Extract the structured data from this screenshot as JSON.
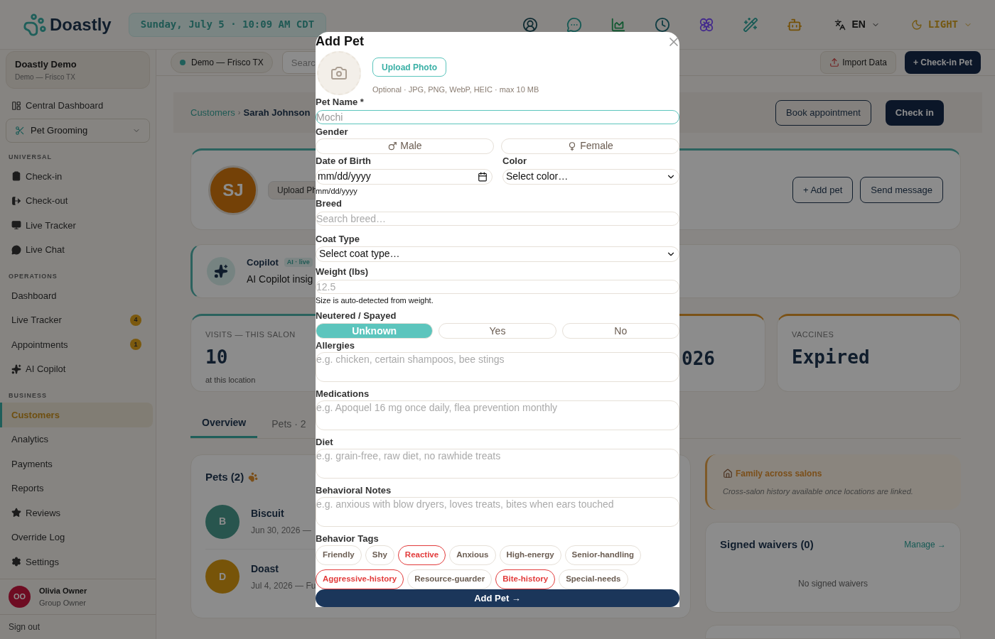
{
  "top_bar": {
    "logo": "Doastly",
    "datetime": "Sunday, July 5 · 10:09 AM CDT",
    "language": "EN",
    "theme": "LIGHT"
  },
  "sidebar": {
    "account": {
      "name": "Doastly Demo",
      "location": "Demo — Frisco TX"
    },
    "central_dashboard": "Central Dashboard",
    "business_type": "Pet Grooming",
    "sections": [
      {
        "title": "UNIVERSAL",
        "items": [
          {
            "label": "Check-in",
            "selected": false
          },
          {
            "label": "Check-out",
            "selected": false
          },
          {
            "label": "Live Tracker",
            "selected": false
          },
          {
            "label": "Live Chat",
            "selected": false
          }
        ]
      },
      {
        "title": "OPERATIONS",
        "items": [
          {
            "label": "Dashboard",
            "selected": false
          },
          {
            "label": "Live Tracker",
            "selected": false,
            "badge": "4"
          },
          {
            "label": "Appointments",
            "selected": false,
            "badge": "1"
          },
          {
            "label": "AI Copilot",
            "selected": false
          }
        ]
      },
      {
        "title": "BUSINESS",
        "items": [
          {
            "label": "Customers",
            "selected": true
          },
          {
            "label": "Analytics",
            "selected": false
          },
          {
            "label": "Payments",
            "selected": false
          },
          {
            "label": "Reports",
            "selected": false
          },
          {
            "label": "Reviews",
            "selected": false
          },
          {
            "label": "Override Log",
            "selected": false
          },
          {
            "label": "Settings",
            "selected": false
          }
        ]
      }
    ],
    "user": {
      "initials": "OO",
      "name": "Olivia Owner",
      "role": "Group Owner"
    },
    "sign_out": "Sign out"
  },
  "toolbar": {
    "location": "Demo — Frisco TX",
    "search_placeholder": "Searc",
    "import": "Import Data",
    "check_in_pet": "+ Check-in Pet"
  },
  "customer": {
    "breadcrumb": {
      "parent": "Customers",
      "separator": "›",
      "current": "Sarah Johnson"
    },
    "actions": [
      "Book appointment",
      "Check in"
    ],
    "initials": "SJ",
    "upload": "Upload Ph",
    "card_actions": [
      "+ Add pet",
      "Send message"
    ],
    "copilot": {
      "title": "Copilot",
      "badge": "AI · live",
      "text": "AI Copilot insig"
    },
    "stats": [
      {
        "label": "VISITS — THIS SALON",
        "value": "10",
        "note": "at this location"
      },
      {
        "value": "026"
      },
      {
        "label": "VACCINES",
        "value": "Expired"
      }
    ],
    "tabs": [
      {
        "label": "Overview",
        "selected": true
      },
      {
        "label": "Pets · 2",
        "selected": false
      }
    ],
    "pets_title": "Pets (2)",
    "pets": [
      {
        "initial": "B",
        "name": "Biscuit",
        "detail": "Jun 30, 2026 —"
      },
      {
        "initial": "D",
        "name": "Doast",
        "detail": "Jul 4, 2026 — Fu"
      }
    ],
    "family": {
      "title": "Family across salons",
      "text": "Cross-salon history available once locations are linked."
    },
    "waivers": {
      "title": "Signed waivers (0)",
      "link": "Manage →",
      "empty": "No signed waivers"
    }
  },
  "modal": {
    "title": "Add Pet",
    "upload_button": "Upload Photo",
    "upload_hint": "Optional · JPG, PNG, WebP, HEIC · max 10 MB",
    "pet_name": {
      "label": "Pet Name *",
      "placeholder": "Mochi"
    },
    "gender": {
      "label": "Gender",
      "options": [
        {
          "label": "Male",
          "selected": false
        },
        {
          "label": "Female",
          "selected": false
        }
      ]
    },
    "date_of_birth": {
      "label": "Date of Birth",
      "value": "mm/dd/yyyy",
      "hint": "mm/dd/yyyy"
    },
    "color": {
      "label": "Color",
      "value": "Select color…"
    },
    "breed": {
      "label": "Breed",
      "placeholder": "Search breed…"
    },
    "coat_type": {
      "label": "Coat Type",
      "value": "Select coat type…"
    },
    "weight": {
      "label": "Weight (lbs)",
      "placeholder": "12.5",
      "hint": "Size is auto-detected from weight."
    },
    "neutered": {
      "label": "Neutered / Spayed",
      "options": [
        {
          "label": "Unknown",
          "selected": true
        },
        {
          "label": "Yes",
          "selected": false
        },
        {
          "label": "No",
          "selected": false
        }
      ]
    },
    "notes": [
      {
        "label": "Allergies",
        "placeholder": "e.g. chicken, certain shampoos, bee stings"
      },
      {
        "label": "Medications",
        "placeholder": "e.g. Apoquel 16 mg once daily, flea prevention monthly"
      },
      {
        "label": "Diet",
        "placeholder": "e.g. grain-free, raw diet, no rawhide treats"
      },
      {
        "label": "Behavioral Notes",
        "placeholder": "e.g. anxious with blow dryers, loves treats, bites when ears touched"
      }
    ],
    "behavior_tags": {
      "label": "Behavior Tags",
      "tags": [
        {
          "label": "Friendly",
          "warning": false
        },
        {
          "label": "Shy",
          "warning": false
        },
        {
          "label": "Reactive",
          "warning": true
        },
        {
          "label": "Anxious",
          "warning": false
        },
        {
          "label": "High-energy",
          "warning": false
        },
        {
          "label": "Senior-handling",
          "warning": false
        },
        {
          "label": "Aggressive-history",
          "warning": true
        },
        {
          "label": "Resource-guarder",
          "warning": false
        },
        {
          "label": "Bite-history",
          "warning": true
        },
        {
          "label": "Special-needs",
          "warning": false
        }
      ]
    },
    "submit": "Add Pet →"
  }
}
